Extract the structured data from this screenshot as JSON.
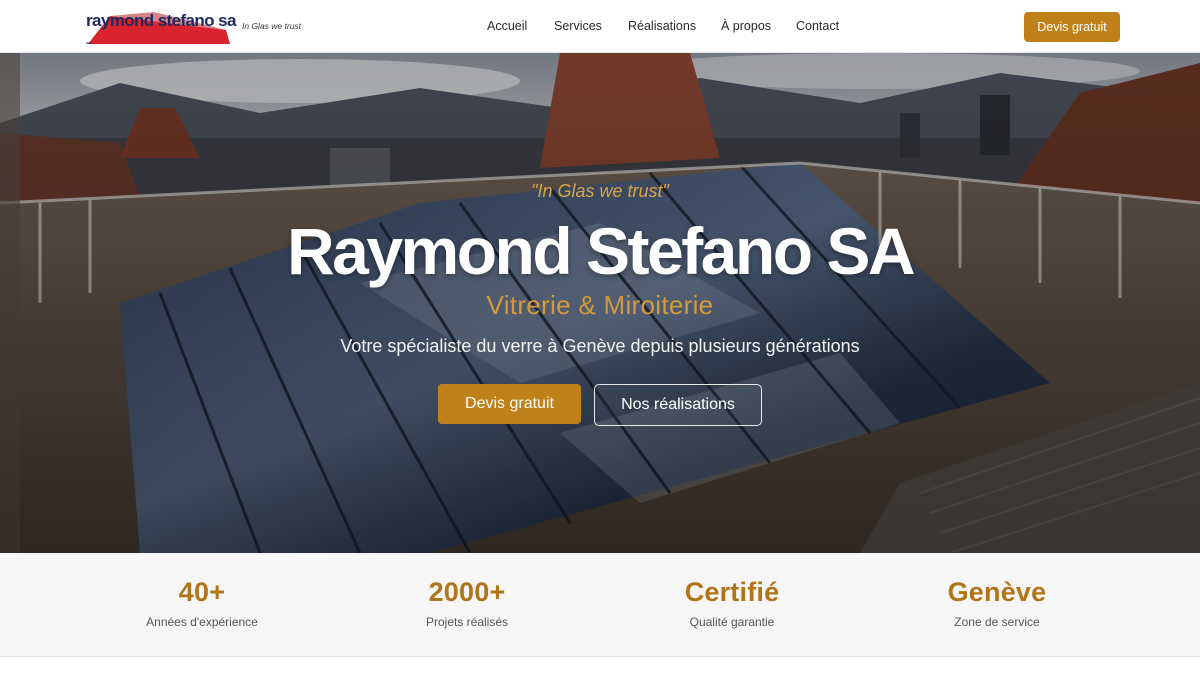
{
  "header": {
    "logo_text": "raymond stefano sa",
    "tagline": "In Glas we trust",
    "nav": [
      "Accueil",
      "Services",
      "Réalisations",
      "À propos",
      "Contact"
    ],
    "cta_label": "Devis gratuit"
  },
  "hero": {
    "quote": "\"In Glas we trust\"",
    "title": "Raymond Stefano SA",
    "subtitle": "Vitrerie & Miroiterie",
    "description": "Votre spécialiste du verre à Genève depuis plusieurs générations",
    "primary_button": "Devis gratuit",
    "secondary_button": "Nos réalisations"
  },
  "stats": [
    {
      "value": "40+",
      "label": "Années d'expérience"
    },
    {
      "value": "2000+",
      "label": "Projets réalisés"
    },
    {
      "value": "Certifié",
      "label": "Qualité garantie"
    },
    {
      "value": "Genève",
      "label": "Zone de service"
    }
  ],
  "colors": {
    "accent": "#c0811a",
    "accent_text": "#b07419",
    "logo_red": "#d9232e",
    "logo_blue": "#1c2a5e"
  }
}
